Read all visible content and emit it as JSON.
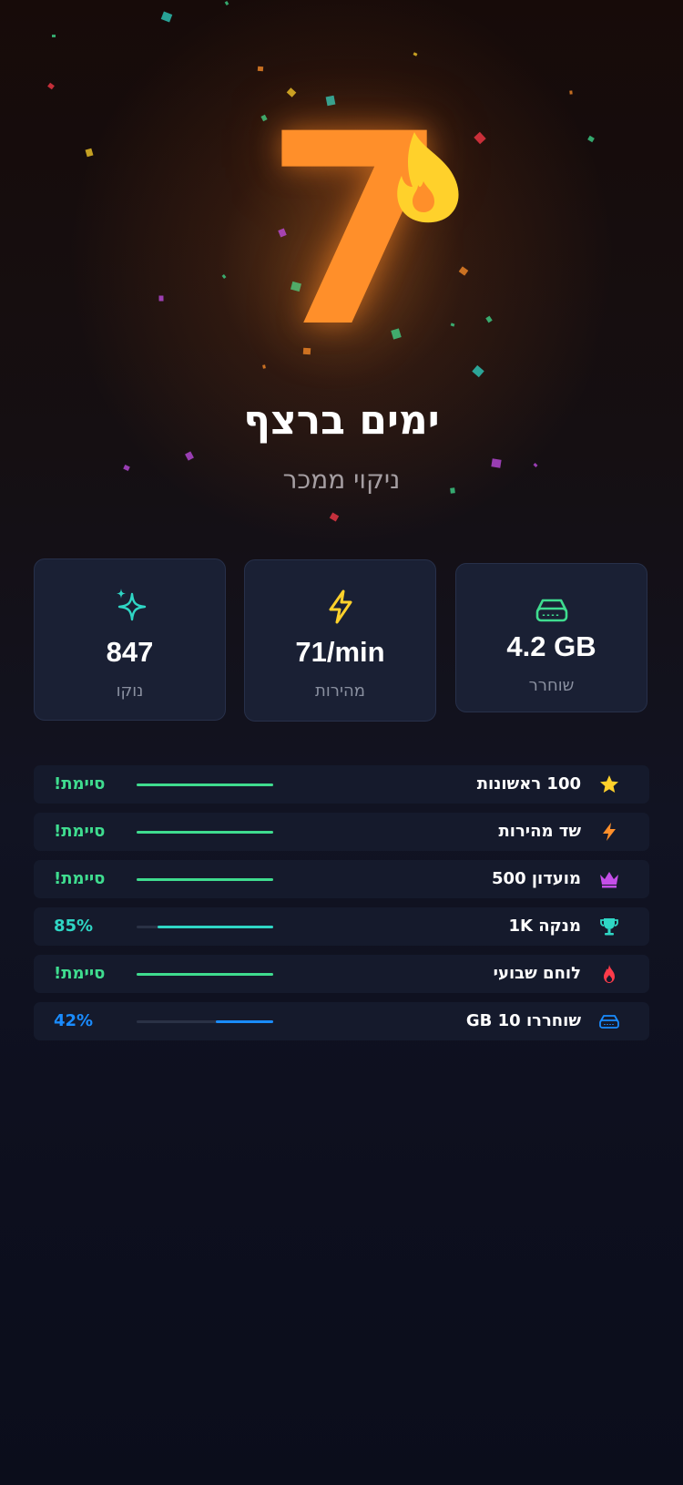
{
  "hero": {
    "streak_number": "7",
    "title": "ימים ברצף",
    "subtitle": "ניקוי ממכר"
  },
  "stats": [
    {
      "icon": "drive-icon",
      "value": "4.2 GB",
      "label": "שוחרר",
      "color": "#3fdc8f"
    },
    {
      "icon": "lightning-icon",
      "value": "71/min",
      "label": "מהירות",
      "color": "#ffd12b"
    },
    {
      "icon": "sparkles-icon",
      "value": "847",
      "label": "נוקו",
      "color": "#2fd6c5"
    }
  ],
  "achievements": [
    {
      "icon": "star-icon",
      "name": "100 ראשונות",
      "status": "!סיימת",
      "progress": 1.0,
      "color": "#3fdc8f",
      "icon_color": "#ffd12b"
    },
    {
      "icon": "lightning-icon",
      "name": "שד מהירות",
      "status": "!סיימת",
      "progress": 1.0,
      "color": "#3fdc8f",
      "icon_color": "#ff8f2a"
    },
    {
      "icon": "crown-icon",
      "name": "מועדון 500",
      "status": "!סיימת",
      "progress": 1.0,
      "color": "#3fdc8f",
      "icon_color": "#c44ee8"
    },
    {
      "icon": "trophy-icon",
      "name": "מנקה 1K",
      "status": "85%",
      "progress": 0.85,
      "color": "#2fd6c5",
      "icon_color": "#2fd6c5"
    },
    {
      "icon": "flame-icon",
      "name": "לוחם שבועי",
      "status": "!סיימת",
      "progress": 1.0,
      "color": "#3fdc8f",
      "icon_color": "#ff3b4a"
    },
    {
      "icon": "drive-icon",
      "name": "שוחררו 10 GB",
      "status": "42%",
      "progress": 0.42,
      "color": "#1a8cff",
      "icon_color": "#1a8cff"
    }
  ],
  "colors": {
    "accent_orange": "#ff8f2a",
    "flame_yellow": "#ffd12b",
    "success_green": "#3fdc8f"
  }
}
